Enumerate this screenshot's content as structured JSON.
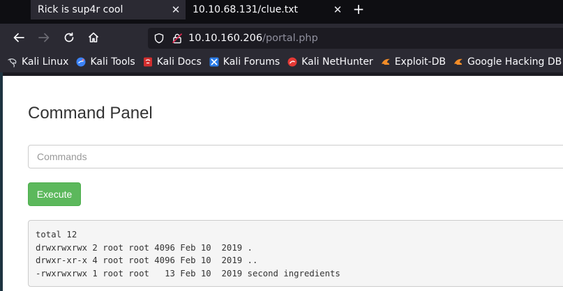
{
  "tabs": [
    {
      "label": "Rick is sup4r cool",
      "close": "✕"
    },
    {
      "label": "10.10.68.131/clue.txt",
      "close": "✕"
    }
  ],
  "new_tab_label": "+",
  "nav": {
    "url_host": "10.10.160.206",
    "url_path": "/portal.php"
  },
  "bookmarks": [
    {
      "label": "Kali Linux",
      "icon": "kali-dragon-icon",
      "color": "#cfd2d8"
    },
    {
      "label": "Kali Tools",
      "icon": "kali-tools-icon",
      "color": "#3b82f6"
    },
    {
      "label": "Kali Docs",
      "icon": "kali-docs-icon",
      "color": "#d32f2f"
    },
    {
      "label": "Kali Forums",
      "icon": "kali-forums-icon",
      "color": "#2b7de9"
    },
    {
      "label": "Kali NetHunter",
      "icon": "kali-nethunter-icon",
      "color": "#e53935"
    },
    {
      "label": "Exploit-DB",
      "icon": "exploit-db-icon",
      "color": "#f28c28"
    },
    {
      "label": "Google Hacking DB",
      "icon": "ghdb-icon",
      "color": "#f28c28"
    }
  ],
  "page": {
    "title": "Command Panel",
    "input_placeholder": "Commands",
    "input_value": "",
    "execute_label": "Execute",
    "output_lines": [
      "total 12",
      "drwxrwxrwx 2 root root 4096 Feb 10  2019 .",
      "drwxr-xr-x 4 root root 4096 Feb 10  2019 ..",
      "-rwxrwxrwx 1 root root   13 Feb 10  2019 second ingredients"
    ]
  }
}
